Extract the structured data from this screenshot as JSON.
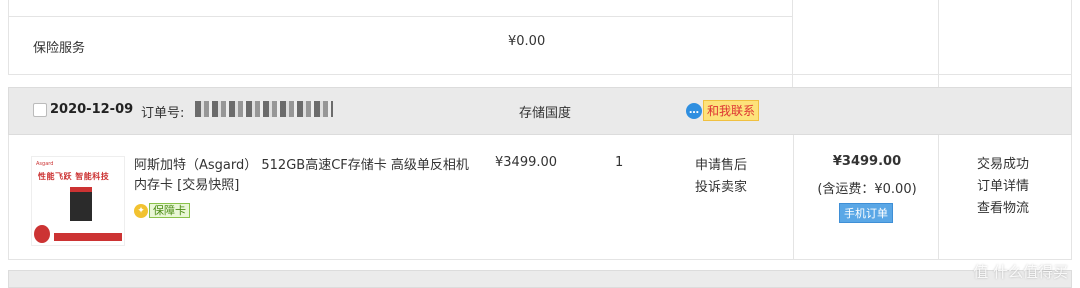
{
  "insurance_row": {
    "label": "保险服务",
    "price": "¥0.00"
  },
  "order": {
    "date": "2020-12-09",
    "order_no_label": "订单号:",
    "shop_name": "存储国度",
    "contact": {
      "icon": "chat-bubble-icon",
      "label": "和我联系"
    }
  },
  "product": {
    "image_text": {
      "brand": "Asgard",
      "title": "性能飞跃 智能科技"
    },
    "title": "阿斯加特（Asgard） 512GB高速CF存储卡 高级单反相机内存卡 [交易快照]",
    "guarantee_label": "保障卡",
    "unit_price": "¥3499.00",
    "quantity": "1",
    "after_sale": [
      "申请售后",
      "投诉卖家"
    ],
    "total_price": "¥3499.00",
    "shipping": "(含运费：¥0.00)",
    "mobile_badge": "手机订单",
    "status_actions": [
      "交易成功",
      "订单详情",
      "查看物流"
    ]
  },
  "watermark": "值 什么值得买"
}
